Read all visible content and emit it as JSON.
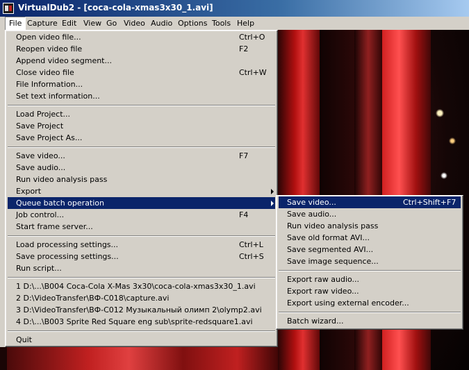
{
  "window": {
    "title": "VirtualDub2 - [coca-cola-xmas3x30_1.avi]"
  },
  "menubar": [
    "File",
    "Capture",
    "Edit",
    "View",
    "Go",
    "Video",
    "Audio",
    "Options",
    "Tools",
    "Help"
  ],
  "file_menu": [
    {
      "label": "Open video file...",
      "shortcut": "Ctrl+O"
    },
    {
      "label": "Reopen video file",
      "shortcut": "F2"
    },
    {
      "label": "Append video segment...",
      "shortcut": ""
    },
    {
      "label": "Close video file",
      "shortcut": "Ctrl+W"
    },
    {
      "label": "File Information...",
      "shortcut": ""
    },
    {
      "label": "Set text information...",
      "shortcut": ""
    },
    {
      "label": "Load Project...",
      "shortcut": ""
    },
    {
      "label": "Save Project",
      "shortcut": ""
    },
    {
      "label": "Save Project As...",
      "shortcut": ""
    },
    {
      "label": "Save video...",
      "shortcut": "F7"
    },
    {
      "label": "Save audio...",
      "shortcut": ""
    },
    {
      "label": "Run video analysis pass",
      "shortcut": ""
    },
    {
      "label": "Export",
      "shortcut": ""
    },
    {
      "label": "Queue batch operation",
      "shortcut": ""
    },
    {
      "label": "Job control...",
      "shortcut": "F4"
    },
    {
      "label": "Start frame server...",
      "shortcut": ""
    },
    {
      "label": "Load processing settings...",
      "shortcut": "Ctrl+L"
    },
    {
      "label": "Save processing settings...",
      "shortcut": "Ctrl+S"
    },
    {
      "label": "Run script...",
      "shortcut": ""
    },
    {
      "label": "1 D:\\...\\B004 Coca-Cola X-Mas 3x30\\coca-cola-xmas3x30_1.avi",
      "shortcut": ""
    },
    {
      "label": "2 D:\\VideoTransfer\\ВФ-C018\\capture.avi",
      "shortcut": ""
    },
    {
      "label": "3 D:\\VideoTransfer\\ВФ-C012 Музыкальный олимп 2\\olymp2.avi",
      "shortcut": ""
    },
    {
      "label": "4 D:\\...\\B003 Sprite Red Square eng sub\\sprite-redsquare1.avi",
      "shortcut": ""
    },
    {
      "label": "Quit",
      "shortcut": ""
    }
  ],
  "queue_submenu": [
    {
      "label": "Save video...",
      "shortcut": "Ctrl+Shift+F7"
    },
    {
      "label": "Save audio...",
      "shortcut": ""
    },
    {
      "label": "Run video analysis pass",
      "shortcut": ""
    },
    {
      "label": "Save old format AVI...",
      "shortcut": ""
    },
    {
      "label": "Save segmented AVI...",
      "shortcut": ""
    },
    {
      "label": "Save image sequence...",
      "shortcut": ""
    },
    {
      "label": "Export raw audio...",
      "shortcut": ""
    },
    {
      "label": "Export raw video...",
      "shortcut": ""
    },
    {
      "label": "Export using external encoder...",
      "shortcut": ""
    },
    {
      "label": "Batch wizard...",
      "shortcut": ""
    }
  ]
}
